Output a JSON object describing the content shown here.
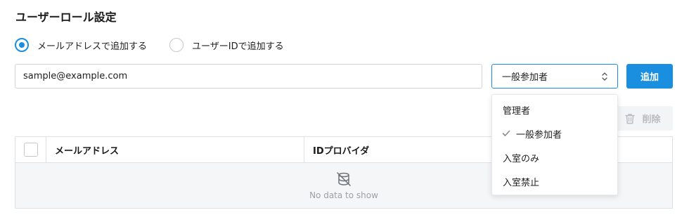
{
  "page": {
    "title": "ユーザーロール設定"
  },
  "add_mode": {
    "options": [
      {
        "label": "メールアドレスで追加する",
        "checked": true
      },
      {
        "label": "ユーザーIDで追加する",
        "checked": false
      }
    ]
  },
  "email_input": {
    "value": "sample@example.com"
  },
  "role_select": {
    "selected": "一般参加者",
    "options": [
      "管理者",
      "一般参加者",
      "入室のみ",
      "入室禁止"
    ]
  },
  "buttons": {
    "add": "追加",
    "delete": "削除"
  },
  "table": {
    "columns": [
      "メールアドレス",
      "IDプロバイダ"
    ],
    "empty_text": "No data to show"
  },
  "colors": {
    "accent": "#1a8fe0",
    "disabled": "#b8bcc0"
  }
}
